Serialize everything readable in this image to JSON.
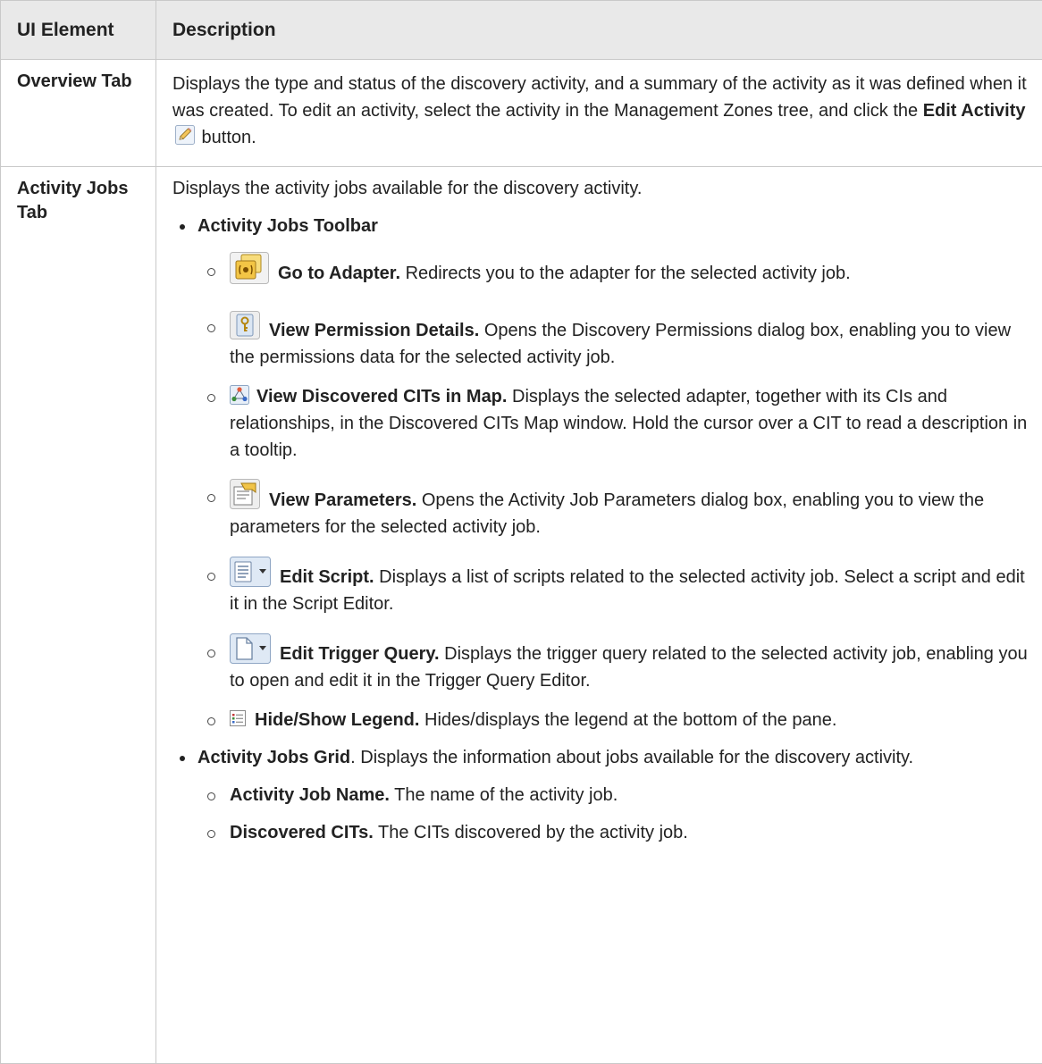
{
  "header": {
    "col1": "UI Element",
    "col2": "Description"
  },
  "overview": {
    "element": "Overview Tab",
    "desc_a": "Displays the type and status of the discovery activity, and a summary of the activity as it was defined when it was created. To edit an activity, select the activity in the Management Zones tree, and click the ",
    "desc_bold": "Edit Activity",
    "desc_b": " button.",
    "icon": "pencil-icon"
  },
  "activity": {
    "element": "Activity Jobs Tab",
    "intro": "Displays the activity jobs available for the discovery activity.",
    "toolbar_title": "Activity Jobs Toolbar",
    "toolbar_items": [
      {
        "icon": "adapter-icon",
        "bold": "Go to Adapter.",
        "text": " Redirects you to the adapter for the selected activity job."
      },
      {
        "icon": "permission-key-icon",
        "bold": "View Permission Details.",
        "text": " Opens the Discovery Permissions dialog box, enabling you to view the permissions data for the selected activity job."
      },
      {
        "icon": "cit-map-icon",
        "bold": "View Discovered CITs in Map.",
        "text": " Displays the selected adapter, together with its CIs and relationships, in the Discovered CITs Map window. Hold the cursor over a CIT to read a description in a tooltip."
      },
      {
        "icon": "parameters-icon",
        "bold": "View Parameters.",
        "text": " Opens the Activity Job Parameters dialog box, enabling you to view the parameters for the selected activity job."
      },
      {
        "icon": "edit-script-icon",
        "bold": "Edit Script.",
        "text": " Displays a list of scripts related to the selected activity job. Select a script and edit it in the Script Editor."
      },
      {
        "icon": "trigger-query-icon",
        "bold": "Edit Trigger Query.",
        "text": " Displays the trigger query related to the selected activity job, enabling you to open and edit it in the Trigger Query Editor."
      },
      {
        "icon": "legend-icon",
        "bold": "Hide/Show Legend.",
        "text": " Hides/displays the legend at the bottom of the pane."
      }
    ],
    "grid_title": "Activity Jobs Grid",
    "grid_text": ". Displays the information about jobs available for the discovery activity.",
    "grid_items": [
      {
        "bold": "Activity Job Name.",
        "text": " The name of the activity job."
      },
      {
        "bold": "Discovered CITs.",
        "text": " The CITs discovered by the activity job."
      }
    ]
  }
}
